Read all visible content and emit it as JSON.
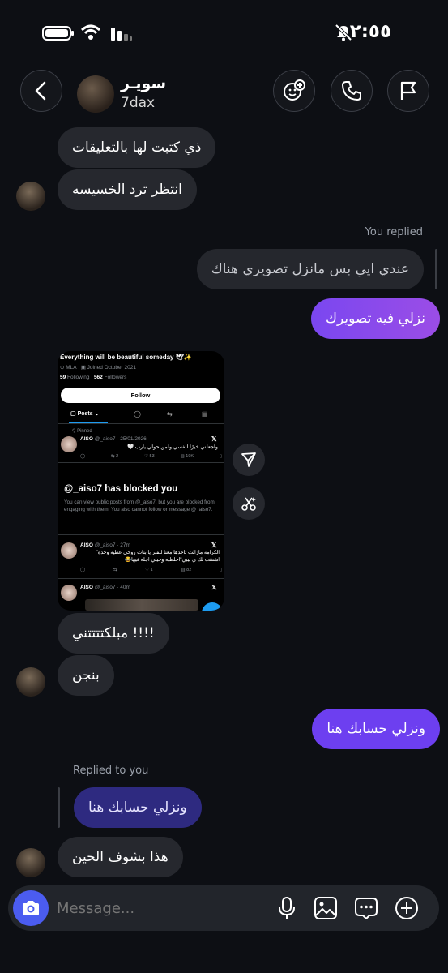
{
  "status_bar": {
    "time": "٢:٥٥"
  },
  "header": {
    "name": "سويـر",
    "username": "7dax"
  },
  "messages": {
    "m1": "ذي كتبت لها بالتعليقات",
    "m2": "انتظر ترد الخسيسه",
    "replied_label": "You replied",
    "m3_quoted": "عندي ايي بس مانزل تصويري هناك",
    "m4": "نزلي فيه تصويرك",
    "m5": "مبلكتتتتني !!!!",
    "m6": "بنجن",
    "m7": "ونزلي حسابك هنا",
    "replied_to_you_label": "Replied to you",
    "m8_quoted": "ونزلي حسابك هنا",
    "m9": "هذا بشوف الحين"
  },
  "shared_card": {
    "bio": "Everything will be beautiful someday 🕊✨",
    "location": "MLA",
    "joined": "Joined October 2021",
    "following_count": "59",
    "following_label": "Following",
    "followers_count": "562",
    "followers_label": "Followers",
    "follow_button": "Follow",
    "posts_tab": "Posts",
    "pinned_label": "Pinned",
    "post1_name": "AISO",
    "post1_meta": "@_aiso7 · 25/01/2026",
    "post1_text": "واجعلني خيرًا لنفسي ولمن حولي يارب 🤍",
    "post1_stats": [
      "2",
      "53",
      "19K"
    ],
    "blocked_title": "@_aiso7 has blocked you",
    "blocked_body": "You can view public posts from @_aiso7, but you are blocked from engaging with them. You also cannot follow or message @_aiso7.",
    "post2_name": "AISO",
    "post2_meta": "@_aiso7 · 27m",
    "post2_text": "الكرامه مازالت تأخذها معنا للقبر يا بنات روحي عطيه وحده\" اشتقت لك ي بيبي\"اجلطيه وجيبي اجله فيها😂",
    "post2_stats": [
      "1",
      "82"
    ],
    "post3_name": "AISO",
    "post3_meta": "@_aiso7 · 40m"
  },
  "composer": {
    "placeholder": "Message..."
  },
  "colors": {
    "background": "#0d0f14",
    "incoming_bubble": "#26282e",
    "outgoing_bubble": "#8b4ae9",
    "outgoing_bubble_alt": "#6d3ff0",
    "camera_button": "#4b5cf0"
  },
  "icons": [
    "battery-icon",
    "wifi-icon",
    "signal-icon",
    "mute-bell-icon",
    "back-icon",
    "add-person-icon",
    "phone-icon",
    "flag-icon",
    "share-icon",
    "scissors-icon",
    "camera-icon",
    "mic-icon",
    "gallery-icon",
    "sticker-chat-icon",
    "plus-icon"
  ]
}
